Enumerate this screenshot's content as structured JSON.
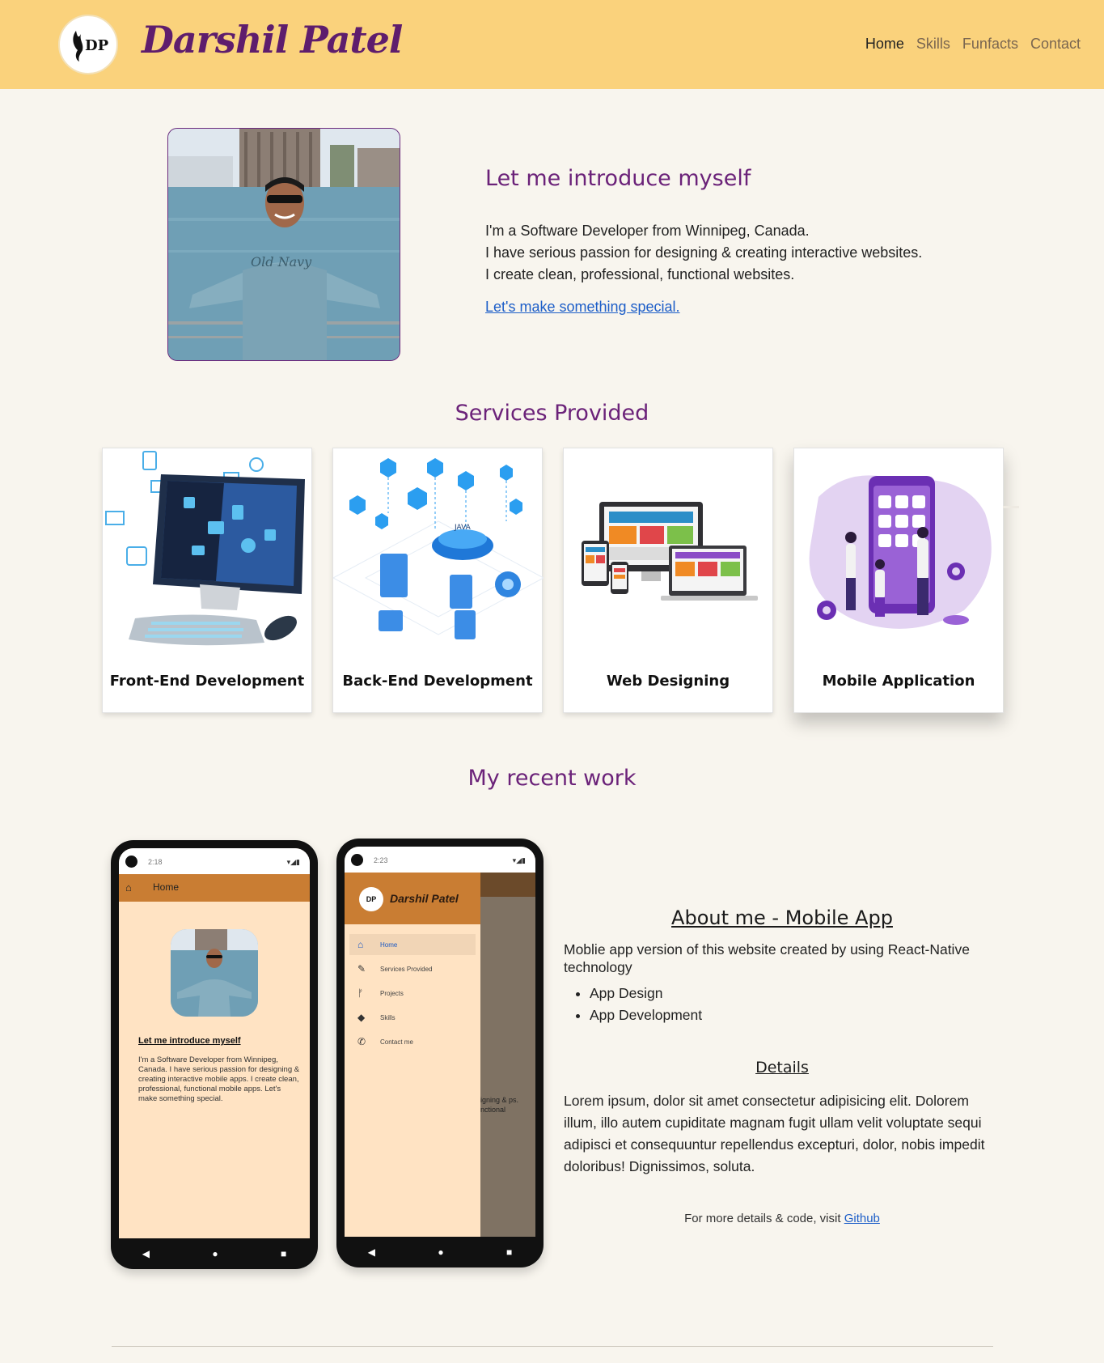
{
  "header": {
    "logo_text": "DP",
    "brand": "Darshil Patel",
    "nav": [
      {
        "label": "Home",
        "active": true
      },
      {
        "label": "Skills"
      },
      {
        "label": "Funfacts"
      },
      {
        "label": "Contact"
      }
    ],
    "background": "#fad27c"
  },
  "intro": {
    "title": "Let me introduce myself",
    "lines": [
      "I'm a Software Developer from Winnipeg, Canada.",
      "I have serious passion for designing & creating interactive websites.",
      "I create clean, professional, functional websites."
    ],
    "cta": "Let's make something special."
  },
  "services": {
    "title": "Services Provided",
    "items": [
      {
        "label": "Front-End Development",
        "icon": "computer-illustration"
      },
      {
        "label": "Back-End Development",
        "icon": "server-network-illustration"
      },
      {
        "label": "Web Designing",
        "icon": "responsive-devices-illustration"
      },
      {
        "label": "Mobile Application",
        "icon": "mobile-app-illustration"
      }
    ]
  },
  "work": {
    "title": "My recent work",
    "phone1": {
      "time": "2:18",
      "bar_title": "Home",
      "heading": "Let me introduce myself",
      "text": "I'm a Software Developer from Winnipeg, Canada. I have serious passion for designing & creating interactive mobile apps. I create clean, professional, functional mobile apps. Let's make something special."
    },
    "phone2": {
      "time": "2:23",
      "logo_text": "DP",
      "brand": "Darshil Patel",
      "menu": [
        "Home",
        "Services Provided",
        "Projects",
        "Skills",
        "Contact me"
      ],
      "behind_text": "igning & ps. nctional"
    },
    "project": {
      "title": "About me - Mobile App",
      "description": "Moblie app version of this website created by using React-Native technology",
      "bullets": [
        "App Design",
        "App Development"
      ],
      "details_title": "Details",
      "details_text": "Lorem ipsum, dolor sit amet consectetur adipisicing elit. Dolorem illum, illo autem cupiditate magnam fugit ullam velit voluptate sequi adipisci et consequuntur repellendus excepturi, dolor, nobis impedit doloribus! Dignissimos, soluta.",
      "more_prefix": "For more details & code, visit",
      "more_link": "Github"
    }
  }
}
